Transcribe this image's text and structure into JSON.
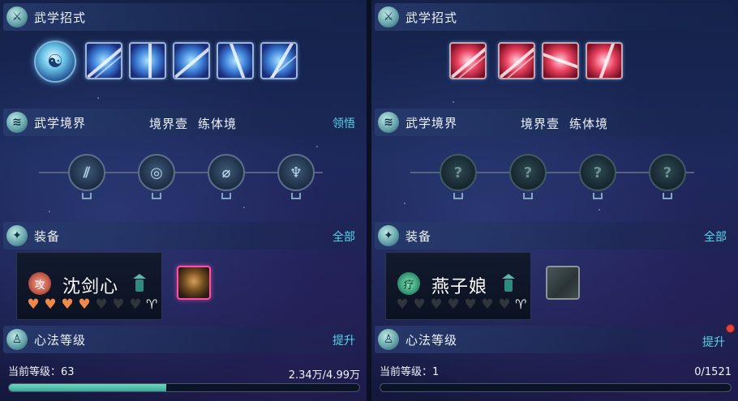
{
  "left": {
    "skills_title": "武学招式",
    "realm_title": "武学境界",
    "realm_level": "境界壹",
    "realm_name": "练体境",
    "realm_action": "领悟",
    "equip_title": "装备",
    "equip_action": "全部",
    "equip_name": "沈剑心",
    "equip_badge": "攻",
    "hearts_full": 4,
    "hearts_total": 7,
    "mind_title": "心法等级",
    "mind_action": "提升",
    "level_text": "当前等级：63",
    "exp_text": "2.34万/4.99万",
    "progress": 0.45
  },
  "right": {
    "skills_title": "武学招式",
    "realm_title": "武学境界",
    "realm_level": "境界壹",
    "realm_name": "练体境",
    "equip_title": "装备",
    "equip_action": "全部",
    "equip_name": "燕子娘",
    "equip_badge": "疗",
    "hearts_full": 0,
    "hearts_total": 7,
    "mind_title": "心法等级",
    "mind_action": "提升",
    "level_text": "当前等级：1",
    "exp_text": "0/1521",
    "progress": 0.0
  },
  "colors": {
    "accent": "#55d6e8",
    "heart_full": "#f08a4b",
    "progress": "#3aa896",
    "notify_dot": "#e0463d"
  }
}
